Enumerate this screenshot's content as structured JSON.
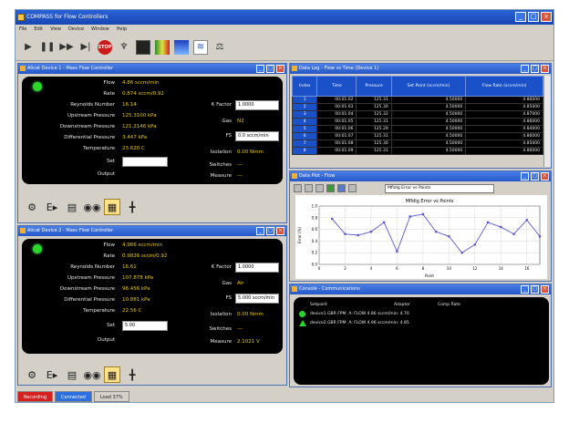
{
  "window": {
    "title": "COMPASS for Flow Controllers"
  },
  "menu": {
    "items": [
      "File",
      "Edit",
      "View",
      "Device",
      "Window",
      "Help"
    ]
  },
  "toolbar": {
    "stop_label": "STOP"
  },
  "device1": {
    "title": "Alicat Device 1 - Mass Flow Controller",
    "labels": {
      "flow": "Flow",
      "rate": "Rate",
      "reynolds": "Reynolds Number",
      "up_pressure": "Upstream Pressure",
      "down_pressure": "Downstream Pressure",
      "diff_pressure": "Differential Pressure",
      "temperature": "Temperature",
      "set": "Set",
      "output": "Output",
      "k_factor": "K Factor",
      "gas": "Gas",
      "fs": "FS",
      "isolation": "Isolation",
      "switches": "Switches",
      "measure": "Measure"
    },
    "values": {
      "flow": "4.86 sccm/min",
      "rate": "0.874 sccm/0.92",
      "reynolds": "16.14",
      "up_pressure": "125.3100 kPa",
      "down_pressure": "121.2146 kPa",
      "diff_pressure": "3.447 kPa",
      "temperature": "23.620 C",
      "set": "",
      "output": "",
      "k_factor": "1.0000",
      "gas": "N2",
      "fs": "0.0 sccm/min",
      "isolation": "0.00 Nmm",
      "switches": "---",
      "measure": "---"
    }
  },
  "device2": {
    "title": "Alicat Device 2 - Mass Flow Controller",
    "labels": {
      "flow": "Flow",
      "rate": "Rate",
      "reynolds": "Reynolds Number",
      "up_pressure": "Upstream Pressure",
      "down_pressure": "Downstream Pressure",
      "diff_pressure": "Differential Pressure",
      "temperature": "Temperature",
      "set": "Set",
      "output": "Output",
      "k_factor": "K Factor",
      "gas": "Gas",
      "fs": "FS",
      "isolation": "Isolation",
      "switches": "Switches",
      "measure": "Measure"
    },
    "values": {
      "flow": "4.966 sccm/min",
      "rate": "0.9826 sccm/0.92",
      "reynolds": "16.61",
      "up_pressure": "107.878 kPa",
      "down_pressure": "96.456 kPa",
      "diff_pressure": "10.881 kPa",
      "temperature": "22.56 C",
      "set": "5.00",
      "output": "",
      "k_factor": "1.0000",
      "gas": "Air",
      "fs": "5.000 sccm/min",
      "isolation": "0.00 Nmm",
      "switches": "---",
      "measure": "2.1021 V"
    }
  },
  "datalog": {
    "title": "Data Log - Flow vs Time (Device 1)",
    "columns": [
      "Index",
      "Time",
      "Pressure",
      "Set Point (sccm/min)",
      "Flow Rate (sccm/min)"
    ],
    "rows": [
      [
        "1",
        "00:01:02",
        "125.31",
        "4.50000",
        "4.86000"
      ],
      [
        "2",
        "00:01:03",
        "125.30",
        "4.50000",
        "4.85000"
      ],
      [
        "3",
        "00:01:04",
        "125.32",
        "4.50000",
        "4.87000"
      ],
      [
        "4",
        "00:01:05",
        "125.31",
        "4.50000",
        "4.86000"
      ],
      [
        "5",
        "00:01:06",
        "125.29",
        "4.50000",
        "4.84000"
      ],
      [
        "6",
        "00:01:07",
        "125.31",
        "4.50000",
        "4.86000"
      ],
      [
        "7",
        "00:01:08",
        "125.30",
        "4.50000",
        "4.85000"
      ],
      [
        "8",
        "00:01:09",
        "125.31",
        "4.50000",
        "4.86000"
      ]
    ]
  },
  "plotwin": {
    "title": "Data Plot - Flow",
    "dropdown": "Mfldlg Error vs Points",
    "toolbar_icons": [
      "zoom-icon",
      "pan-icon",
      "print-icon",
      "save-icon",
      "copy-icon",
      "grid-icon"
    ]
  },
  "chart_data": {
    "type": "line",
    "title": "Mfldlg Error vs Points",
    "xlabel": "Point",
    "ylabel": "Error (%)",
    "x": [
      1,
      2,
      3,
      4,
      5,
      6,
      7,
      8,
      9,
      10,
      11,
      12,
      13,
      14,
      15,
      16,
      17
    ],
    "series": [
      {
        "values": [
          0.78,
          0.52,
          0.5,
          0.56,
          0.72,
          0.22,
          0.82,
          0.86,
          0.56,
          0.48,
          0.2,
          0.34,
          0.72,
          0.64,
          0.52,
          0.76,
          0.48
        ]
      }
    ],
    "xticks": [
      "0",
      "2",
      "4",
      "6",
      "8",
      "10",
      "12",
      "14",
      "16"
    ],
    "yticks": [
      "0.0",
      "0.2",
      "0.4",
      "0.6",
      "0.8",
      "1.0"
    ],
    "ylim": [
      0,
      1
    ],
    "xlim": [
      0,
      17
    ],
    "grid": true,
    "line_color": "#5a5ad0"
  },
  "console": {
    "title": "Console - Communications",
    "headers": [
      "Setpoint",
      "Adapter",
      "Comp Rate"
    ],
    "rows": [
      "device1.GBR FPM: A: FLOW 4.86 sccm/min: 4.70",
      "device2.GBR FPM: A: FLOW 4.96 sccm/min: 4.85"
    ],
    "colors": {
      "mark_ok": "#2bd62b"
    }
  },
  "status": {
    "seg1": "Recording",
    "seg2": "Connected",
    "seg3": "Load 37%"
  },
  "colors": {
    "accent": "#1a50c8",
    "value_text": "#e8c800",
    "led": "#2bd62b"
  }
}
